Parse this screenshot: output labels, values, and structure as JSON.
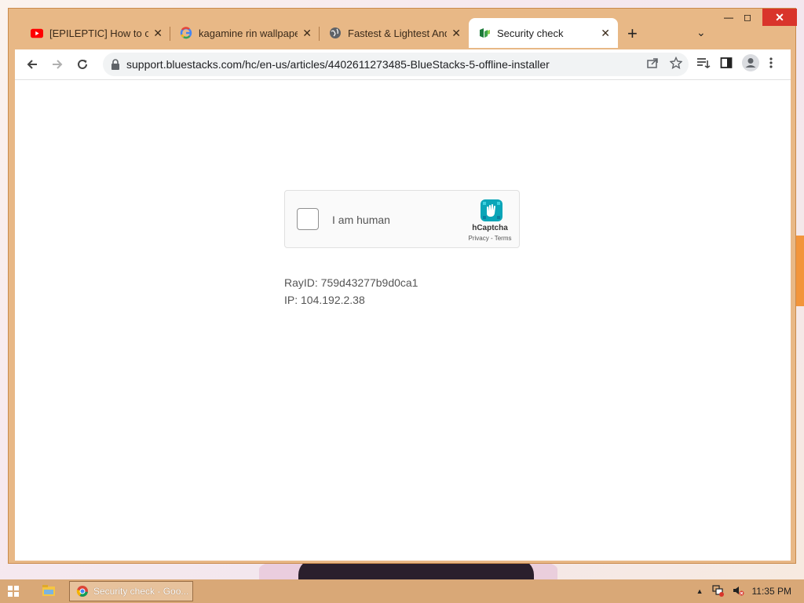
{
  "browser": {
    "tabs": [
      {
        "title": "[EPILEPTIC] How to cod",
        "icon": "youtube-icon"
      },
      {
        "title": "kagamine rin wallpaper",
        "icon": "google-icon"
      },
      {
        "title": "Fastest & Lightest Andr",
        "icon": "globe-icon"
      },
      {
        "title": "Security check",
        "icon": "bluestacks-icon"
      }
    ],
    "new_tab": "+",
    "url": "support.bluestacks.com/hc/en-us/articles/4402611273485-BlueStacks-5-offline-installer"
  },
  "captcha": {
    "label": "I am human",
    "brand": "hCaptcha",
    "privacy": "Privacy",
    "separator": " - ",
    "terms": "Terms"
  },
  "info": {
    "ray": "RayID: 759d43277b9d0ca1",
    "ip": "IP: 104.192.2.38"
  },
  "taskbar": {
    "item": "Security check - Goo...",
    "time": "11:35 PM"
  },
  "colors": {
    "window_frame": "#e8b886",
    "taskbar": "#d9a877",
    "close_button": "#d9342b",
    "hcaptcha_teal": "#0aa5b8"
  }
}
